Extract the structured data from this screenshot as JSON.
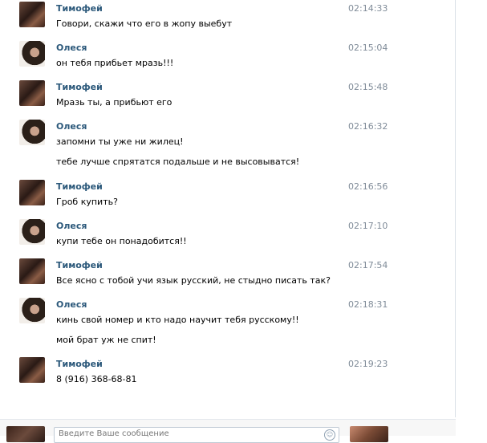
{
  "messages": [
    {
      "author": "Тимофей",
      "avatar": "male",
      "time": "02:14:33",
      "lines": [
        "Говори, скажи что его в жопу выебут"
      ]
    },
    {
      "author": "Олеся",
      "avatar": "female",
      "time": "02:15:04",
      "lines": [
        "он тебя прибьет мразь!!!"
      ]
    },
    {
      "author": "Тимофей",
      "avatar": "male",
      "time": "02:15:48",
      "lines": [
        "Мразь ты, а прибьют его"
      ]
    },
    {
      "author": "Олеся",
      "avatar": "female",
      "time": "02:16:32",
      "lines": [
        "запомни ты уже ни жилец!",
        "тебе лучше спрятатся подальше и не высовыватся!"
      ]
    },
    {
      "author": "Тимофей",
      "avatar": "male",
      "time": "02:16:56",
      "lines": [
        "Гроб купить?"
      ]
    },
    {
      "author": "Олеся",
      "avatar": "female",
      "time": "02:17:10",
      "lines": [
        "купи тебе он понадобится!!"
      ]
    },
    {
      "author": "Тимофей",
      "avatar": "male",
      "time": "02:17:54",
      "lines": [
        "Все ясно с тобой учи язык русский, не стыдно писать так?"
      ]
    },
    {
      "author": "Олеся",
      "avatar": "female",
      "time": "02:18:31",
      "lines": [
        "кинь свой номер и кто надо научит тебя русскому!!",
        "мой брат уж не спит!"
      ]
    },
    {
      "author": "Тимофей",
      "avatar": "male",
      "time": "02:19:23",
      "lines": [
        "8 (916) 368-68-81"
      ]
    }
  ],
  "composer": {
    "placeholder": "Введите Ваше сообщение",
    "smile_icon": "smile-icon"
  },
  "colors": {
    "author": "#2b587a",
    "time": "#7f8b98"
  }
}
